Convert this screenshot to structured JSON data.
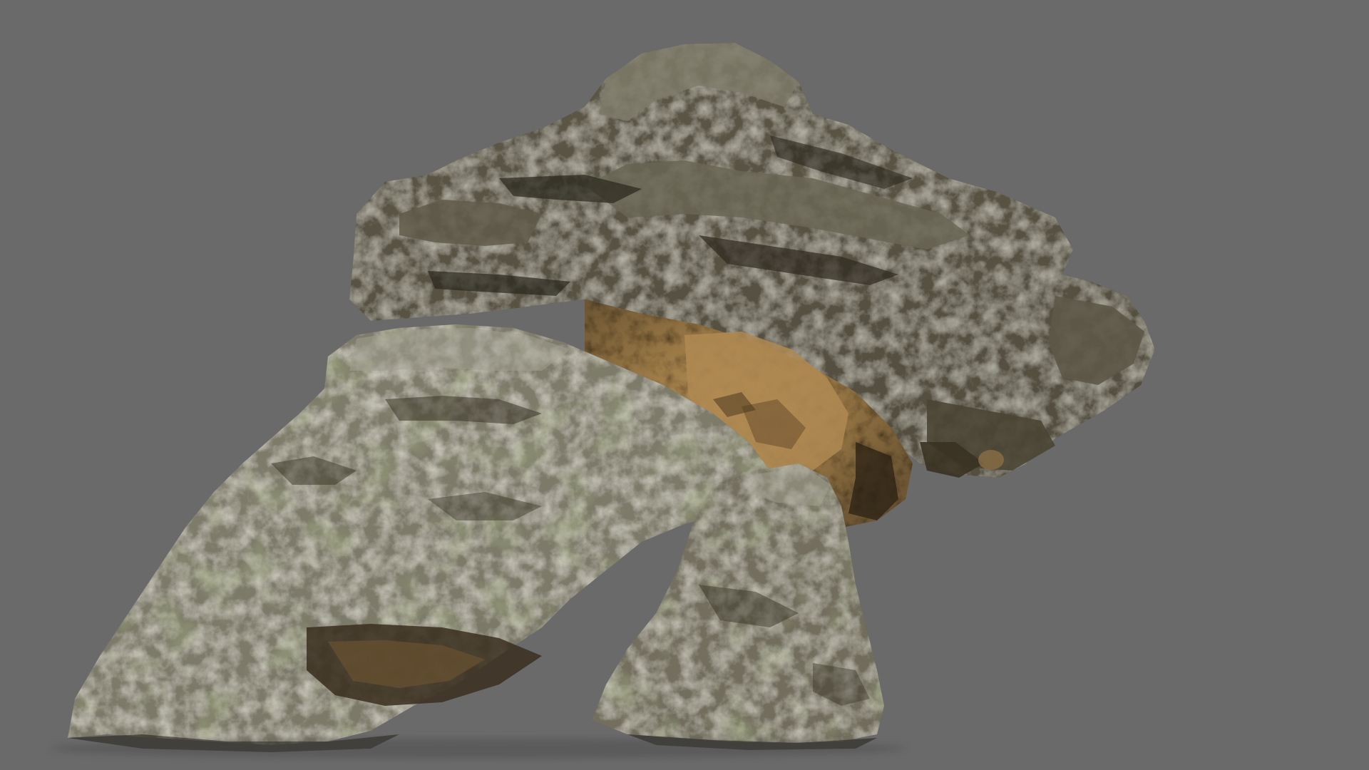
{
  "scene": {
    "background_color": "#6a6a6a",
    "subject": "rock",
    "palette": {
      "rock_dark": "#3a3528",
      "rock_mid": "#5b5646",
      "rock_light": "#8a887a",
      "lichen_pale": "#b8b8ad",
      "moss_green": "#5e6a3a",
      "cave_warm": "#a5834f",
      "cave_glow": "#c49a5e",
      "shadow": "#1e1b14"
    }
  }
}
